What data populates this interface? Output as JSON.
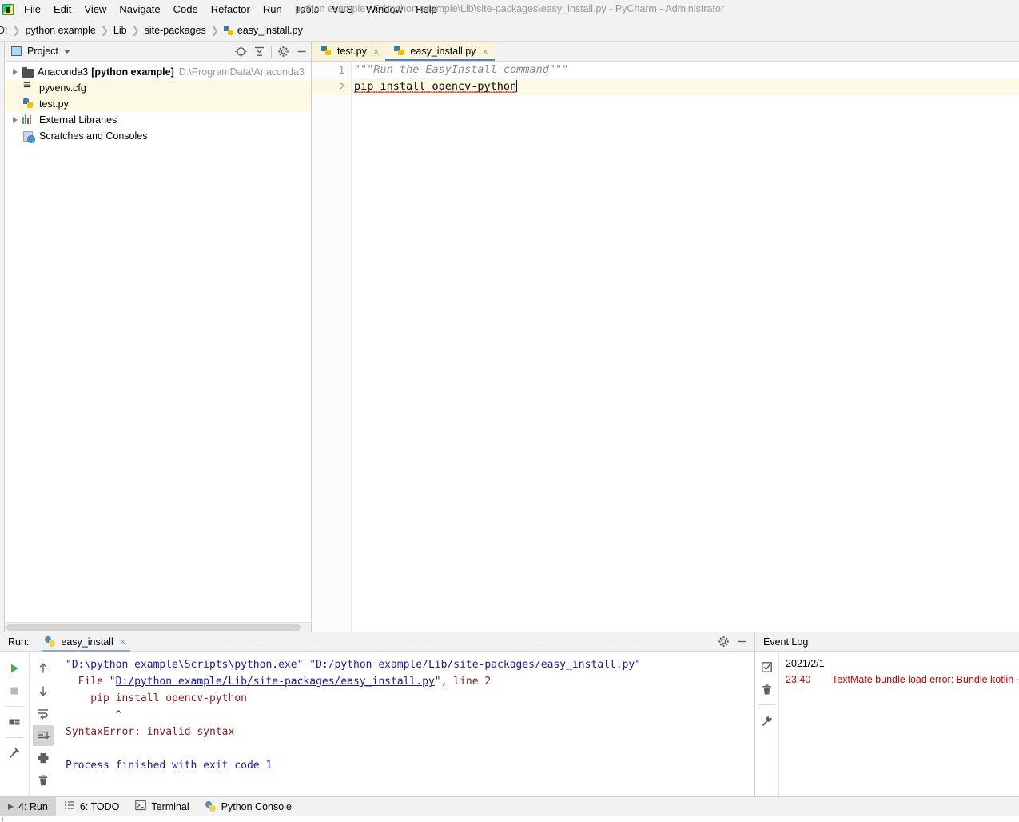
{
  "window": {
    "title": "python example - D:\\python example\\Lib\\site-packages\\easy_install.py - PyCharm - Administrator",
    "app_icon": "pycharm-icon"
  },
  "menubar": {
    "items": [
      {
        "label": "File",
        "mnemonic": "F"
      },
      {
        "label": "Edit",
        "mnemonic": "E"
      },
      {
        "label": "View",
        "mnemonic": "V"
      },
      {
        "label": "Navigate",
        "mnemonic": "N"
      },
      {
        "label": "Code",
        "mnemonic": "C"
      },
      {
        "label": "Refactor",
        "mnemonic": "R"
      },
      {
        "label": "Run",
        "mnemonic": "u"
      },
      {
        "label": "Tools",
        "mnemonic": "T"
      },
      {
        "label": "VCS",
        "mnemonic": "S"
      },
      {
        "label": "Window",
        "mnemonic": "W"
      },
      {
        "label": "Help",
        "mnemonic": "H"
      }
    ]
  },
  "breadcrumb": {
    "drive": "D:",
    "items": [
      "python example",
      "Lib",
      "site-packages"
    ],
    "file": "easy_install.py",
    "separator": "❯"
  },
  "project_panel": {
    "title": "Project",
    "toolbar": [
      "locate-icon",
      "collapse-all-icon",
      "settings-gear-icon",
      "hide-icon"
    ],
    "tree": [
      {
        "label": "Anaconda3",
        "bold_label": "[python example]",
        "path": "D:\\ProgramData\\Anaconda3",
        "icon": "folder-icon",
        "expandable": true,
        "highlighted": false
      },
      {
        "label": "pyvenv.cfg",
        "bold_label": "",
        "path": "",
        "icon": "config-file-icon",
        "expandable": false,
        "highlighted": true
      },
      {
        "label": "test.py",
        "bold_label": "",
        "path": "",
        "icon": "python-file-icon",
        "expandable": false,
        "highlighted": true
      },
      {
        "label": "External Libraries",
        "bold_label": "",
        "path": "",
        "icon": "libraries-icon",
        "expandable": true,
        "highlighted": false
      },
      {
        "label": "Scratches and Consoles",
        "bold_label": "",
        "path": "",
        "icon": "scratches-icon",
        "expandable": false,
        "highlighted": false
      }
    ]
  },
  "editor": {
    "tabs": [
      {
        "label": "test.py",
        "icon": "python-file-icon",
        "active": false,
        "close": "×"
      },
      {
        "label": "easy_install.py",
        "icon": "python-file-icon",
        "active": true,
        "close": "×"
      }
    ],
    "lines": [
      {
        "number": "1",
        "text": "\"\"\"Run the EasyInstall command\"\"\"",
        "style": "docstring",
        "current": false
      },
      {
        "number": "2",
        "text": "pip install opencv-python",
        "style": "plain",
        "current": true
      }
    ]
  },
  "run_panel": {
    "label": "Run:",
    "tab_name": "easy_install",
    "tab_icon": "python-icon",
    "tab_close": "×",
    "header_tools": [
      "settings-gear-icon",
      "hide-icon"
    ],
    "toolbar_left": [
      "rerun-icon",
      "stop-icon",
      "layout-icon",
      "pin-icon"
    ],
    "toolbar_right": [
      "up-arrow-icon",
      "down-arrow-icon",
      "soft-wrap-icon",
      "scroll-to-end-icon",
      "print-icon",
      "trash-icon"
    ],
    "console": {
      "command_line": "\"D:\\python example\\Scripts\\python.exe\" \"D:/python example/Lib/site-packages/easy_install.py\"",
      "file_prefix": "  File \"",
      "file_link": "D:/python example/Lib/site-packages/easy_install.py",
      "file_suffix": "\", line 2",
      "code_line": "    pip install opencv-python",
      "caret_line": "        ^",
      "error_line": "SyntaxError: invalid syntax",
      "exit_line": "Process finished with exit code 1"
    }
  },
  "event_log": {
    "title": "Event Log",
    "toolbar": [
      "mark-read-icon",
      "trash-icon",
      "settings-wrench-icon"
    ],
    "date": "2021/2/1",
    "entries": [
      {
        "time": "23:40",
        "message": "TextMate bundle load error: Bundle kotlin ·"
      }
    ]
  },
  "statusbar": {
    "buttons": [
      {
        "label": "4: Run",
        "mnemonic": "4",
        "icon": "run-triangle-icon",
        "active": true
      },
      {
        "label": "6: TODO",
        "mnemonic": "6",
        "icon": "todo-list-icon",
        "active": false
      },
      {
        "label": "Terminal",
        "mnemonic": "",
        "icon": "terminal-icon",
        "active": false
      },
      {
        "label": "Python Console",
        "mnemonic": "",
        "icon": "python-icon",
        "active": false
      }
    ]
  },
  "colors": {
    "accent_blue": "#4a86c5",
    "error_red": "#cc0000",
    "console_blue": "#1a1aa6",
    "console_red": "#8b1a1a",
    "highlight_yellow": "#fcf9e4",
    "chrome_gray": "#f2f2f2"
  }
}
